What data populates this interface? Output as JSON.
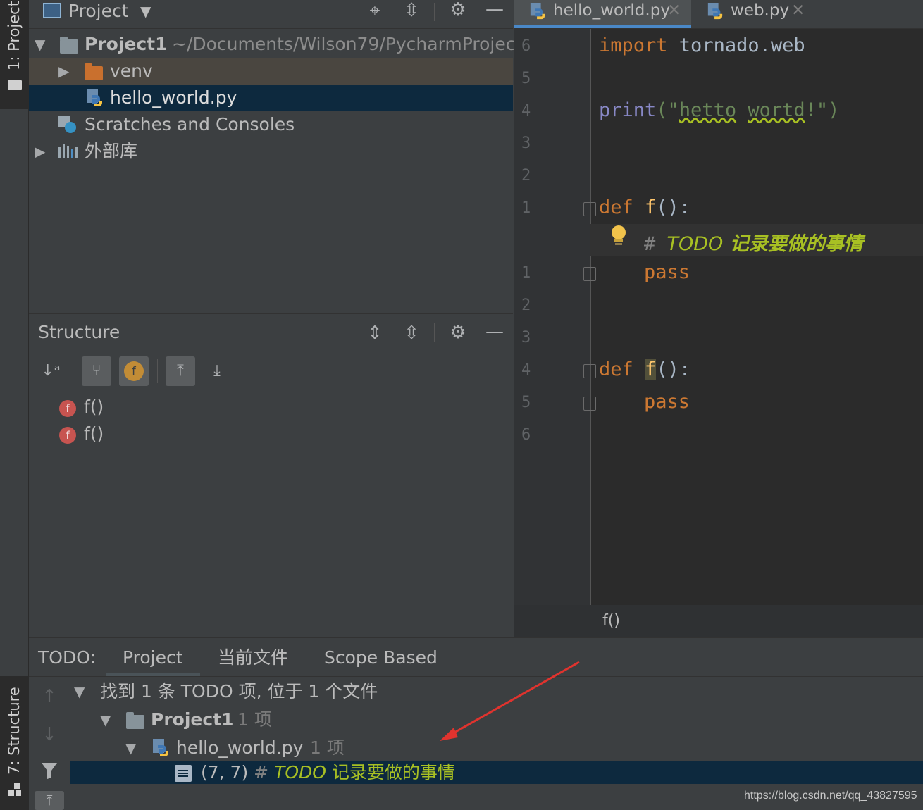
{
  "left_strip": {
    "project_tab": "1: Project",
    "structure_tab": "7: Structure"
  },
  "project_panel": {
    "title": "Project",
    "tree": [
      {
        "label": "Project1",
        "path": "~/Documents/Wilson79/PycharmProject"
      },
      {
        "label": "venv"
      },
      {
        "label": "hello_world.py"
      },
      {
        "label": "Scratches and Consoles"
      },
      {
        "label": "外部库"
      }
    ]
  },
  "editor": {
    "tabs": [
      {
        "label": "hello_world.py",
        "active": true
      },
      {
        "label": "web.py",
        "active": false
      }
    ],
    "line_numbers": [
      "6",
      "5",
      "4",
      "3",
      "2",
      "1",
      "",
      "1",
      "2",
      "3",
      "4",
      "5",
      "6"
    ],
    "code": {
      "l1_kw": "import",
      "l1_rest": " tornado.web",
      "l3_fn": "print",
      "l3_open": "(\"",
      "l3_w1": "hetto",
      "l3_sp": " ",
      "l3_w2": "wortd",
      "l3_close": "!\")",
      "l6_def": "def",
      "l6_name": " f",
      "l6_rest": "():",
      "l7_hash": "# ",
      "l7_todo": "TODO",
      "l7_text": " 记录要做的事情",
      "l8_pass": "pass",
      "l11_def": "def",
      "l11_name": "f",
      "l11_rest": "():",
      "l12_pass": "pass"
    },
    "breadcrumb": "f()"
  },
  "structure_panel": {
    "title": "Structure",
    "items": [
      {
        "badge": "f",
        "label": "f()"
      },
      {
        "badge": "f",
        "label": "f()"
      }
    ],
    "filter_badge": "f"
  },
  "todo_panel": {
    "label": "TODO:",
    "tabs": [
      "Project",
      "当前文件",
      "Scope Based"
    ],
    "summary": "找到 1 条 TODO 项, 位于 1 个文件",
    "project_node": "Project1",
    "project_count": "1 项",
    "file_node": "hello_world.py",
    "file_count": "1 项",
    "item_pos": "(7, 7)",
    "item_hash": "# ",
    "item_todo": "TODO",
    "item_text": " 记录要做的事情"
  },
  "watermark": "https://blog.csdn.net/qq_43827595",
  "colors": {
    "keyword": "#cc7832",
    "todo": "#a8c023",
    "selection": "#0d293e",
    "string": "#6a8759",
    "func": "#ffc66d"
  }
}
